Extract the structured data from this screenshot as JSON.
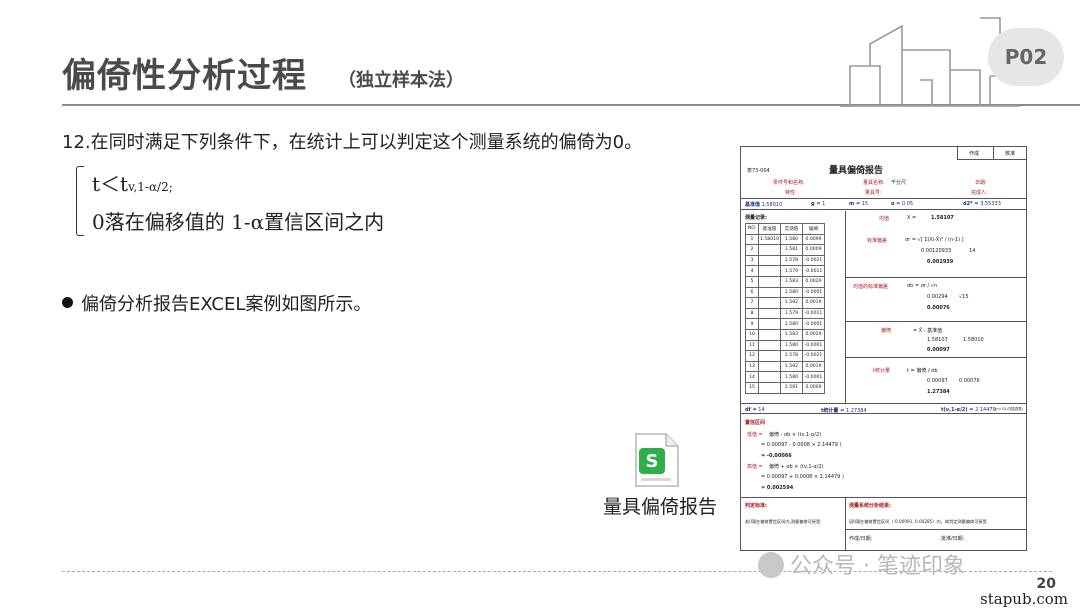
{
  "header": {
    "title": "偏倚性分析过程",
    "subtitle": "（独立样本法）",
    "page_badge": "P02"
  },
  "content": {
    "condition": "12.在同时满足下列条件下，在统计上可以判定这个测量系统的偏倚为0。",
    "formula_1_main": "t＜t",
    "formula_1_sub": "v,1-α/2;",
    "formula_2": "0落在偏移值的 1-α置信区间之内",
    "bullet": "偏倚分析报告EXCEL案例如图所示。"
  },
  "attachment": {
    "icon": "spreadsheet-file-icon",
    "icon_letter": "S",
    "label": "量具偏倚报告",
    "accent": "#2fae4a"
  },
  "report": {
    "top_cells": [
      "作成",
      "核准"
    ],
    "form_no": "表73-004",
    "title": "量具偏倚报告",
    "info": {
      "part_label": "零件号和名称:",
      "gauge_name_label": "量具名称:",
      "gauge_name_value": "千分尺",
      "date_label": "日期:",
      "feature_label": "特性:",
      "gauge_no_label": "量具号:",
      "done_by_label": "完成人:"
    },
    "summary": [
      {
        "label": "基准值",
        "value": "1.58010"
      },
      {
        "label": "g =",
        "value": "1"
      },
      {
        "label": "m =",
        "value": "15"
      },
      {
        "label": "α =",
        "value": "0.05"
      },
      {
        "label": "d2* =",
        "value": "3.55333"
      }
    ],
    "data_title": "测量记录:",
    "columns": [
      "NO.",
      "基准值",
      "实测值",
      "偏倚"
    ],
    "base_value": "1.58010",
    "rows": [
      [
        "1",
        "1.580",
        "0.0099"
      ],
      [
        "2",
        "1.581",
        "0.0009"
      ],
      [
        "3",
        "1.578",
        "-0.0021"
      ],
      [
        "4",
        "1.579",
        "-0.0011"
      ],
      [
        "5",
        "1.583",
        "0.0029"
      ],
      [
        "6",
        "1.580",
        "-0.0001"
      ],
      [
        "7",
        "1.582",
        "0.0019"
      ],
      [
        "8",
        "1.579",
        "-0.0011"
      ],
      [
        "9",
        "1.580",
        "-0.0001"
      ],
      [
        "10",
        "1.583",
        "0.0029"
      ],
      [
        "11",
        "1.580",
        "-0.0001"
      ],
      [
        "12",
        "1.578",
        "-0.0021"
      ],
      [
        "13",
        "1.582",
        "0.0019"
      ],
      [
        "14",
        "1.580",
        "-0.0001"
      ],
      [
        "15",
        "1.581",
        "0.0009"
      ]
    ],
    "stats": {
      "mean_label": "均值",
      "mean_sym": "X =",
      "mean_value": "1.58107",
      "sd_label": "标准偏差",
      "sd_formula": "σr = √[ Σ(Xi-X̄)² / (n-1) ]",
      "sd_value_a": "0.00120933",
      "sd_value_b": "14",
      "sd_value": "0.002939",
      "sem_label": "均值的标准偏差",
      "sem_formula": "σb =  σr / √n",
      "sem_value_a": "0.00294",
      "sem_value_b": "√15",
      "sem_value": "0.00076",
      "bias_label": "偏倚",
      "bias_formula": "= X̄ - 基准值",
      "bias_value_a": "1.58107",
      "bias_value_b": "1.58010",
      "bias_value": "0.00097",
      "t_label": "t统计量",
      "t_formula": "t = 偏倚 / σb",
      "t_value_a": "0.00097",
      "t_value_b": "0.00076",
      "t_value": "1.27384"
    },
    "df_row": {
      "df_label": "df =",
      "df_value": "14",
      "t_stat_label": "t统计量 =",
      "t_stat_value": "1.27384",
      "t_crit_label": "t(ν,1-α/2) =",
      "t_crit_value": "2.14479",
      "note": "(n=15,内插查表)"
    },
    "ci": {
      "title": "置信区间",
      "low_label": "低值 =",
      "low_formula": "偏倚 - σb × (tν,1-α/2)",
      "low_calc": "= 0.00097 - 0.0008 × 2.14479 )",
      "low_value": "= -0.00066",
      "high_label": "高值 =",
      "high_formula": "偏倚 + σb × (tν,1-α/2)",
      "high_calc": "= 0.00097 + 0.0008 × 2.14479 )",
      "high_value": "= 0.002594"
    },
    "judge": {
      "title": "判定标准:",
      "text": "若0落在偏倚置信区间内,测量偏倚可接受.",
      "result_title": "测量系统分析结果:",
      "result_text": "因0落在偏倚置信区间（-0.00091, 0.00285）内，故判定测量偏倚可接受",
      "sign_label": "作成/日期:",
      "approve_label": "批准/日期:"
    }
  },
  "footer": {
    "watermark": "公众号 · 笔迹印象",
    "page_number": "20",
    "site": "stapub.com"
  }
}
